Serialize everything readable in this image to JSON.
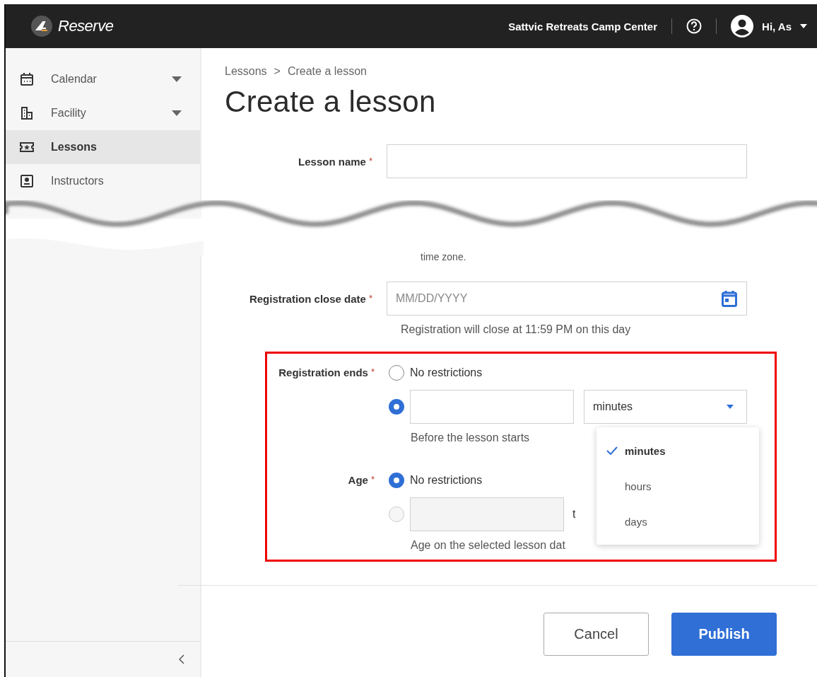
{
  "header": {
    "logo_text": "Reserve",
    "org_name": "Sattvic Retreats Camp Center",
    "user_greeting": "Hi, As"
  },
  "sidebar": {
    "items": [
      {
        "label": "Calendar",
        "expandable": true,
        "selected": false
      },
      {
        "label": "Facility",
        "expandable": true,
        "selected": false
      },
      {
        "label": "Lessons",
        "expandable": false,
        "selected": true
      },
      {
        "label": "Instructors",
        "expandable": false,
        "selected": false
      }
    ]
  },
  "breadcrumb": {
    "items": [
      "Lessons",
      "Create a lesson"
    ],
    "separator": ">"
  },
  "page_title": "Create a lesson",
  "lesson_name": {
    "label": "Lesson name",
    "required_mark": "*"
  },
  "cut_hint": "time zone.",
  "close_date": {
    "label": "Registration close date",
    "required_mark": "*",
    "placeholder": "MM/DD/YYYY",
    "hint": "Registration will close at 11:59 PM on this day"
  },
  "registration_ends": {
    "label": "Registration ends",
    "required_mark": "*",
    "options": [
      {
        "kind": "plain",
        "label": "No restrictions",
        "selected": false
      },
      {
        "kind": "amount",
        "selected": true,
        "unit": "minutes",
        "hint": "Before the lesson starts"
      }
    ]
  },
  "unit_menu": {
    "options": [
      {
        "label": "minutes",
        "selected": true
      },
      {
        "label": "hours",
        "selected": false
      },
      {
        "label": "days",
        "selected": false
      }
    ]
  },
  "age": {
    "label": "Age",
    "required_mark": "*",
    "options": [
      {
        "kind": "plain",
        "label": "No restrictions",
        "selected": true
      },
      {
        "kind": "range",
        "selected": false,
        "disabled": true,
        "separator": "t",
        "hint": "Age on the selected lesson dat"
      }
    ]
  },
  "actions": [
    {
      "label": "Cancel",
      "kind": "secondary"
    },
    {
      "label": "Publish",
      "kind": "primary"
    }
  ]
}
